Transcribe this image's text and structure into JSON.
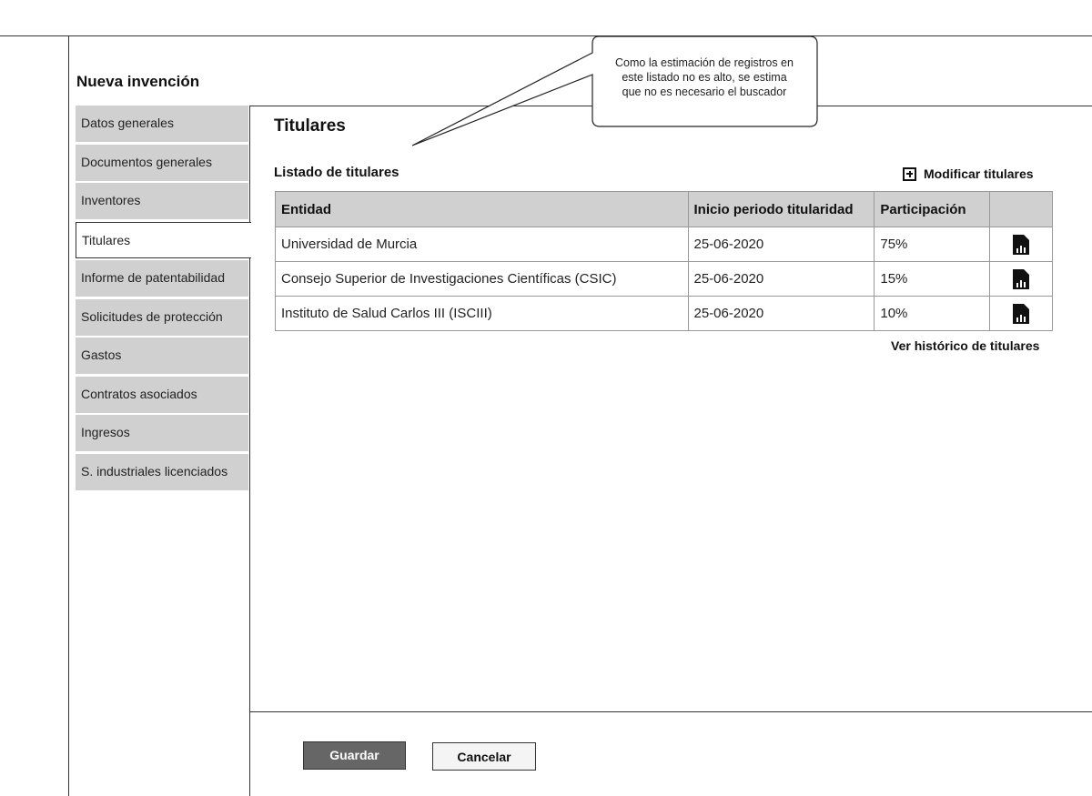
{
  "page": {
    "title": "Nueva invención"
  },
  "nav": {
    "items": [
      {
        "label": "Datos generales",
        "active": false
      },
      {
        "label": "Documentos generales",
        "active": false
      },
      {
        "label": "Inventores",
        "active": false
      },
      {
        "label": "Titulares",
        "active": true
      },
      {
        "label": "Informe de patentabilidad",
        "active": false
      },
      {
        "label": "Solicitudes de protección",
        "active": false
      },
      {
        "label": "Gastos",
        "active": false
      },
      {
        "label": "Contratos asociados",
        "active": false
      },
      {
        "label": "Ingresos",
        "active": false
      },
      {
        "label": "S. industriales licenciados",
        "active": false
      }
    ]
  },
  "section": {
    "title": "Titulares",
    "list_title": "Listado de titulares",
    "modify_label": "Modificar titulares",
    "history_label": "Ver histórico de titulares"
  },
  "table": {
    "headers": [
      "Entidad",
      "Inicio periodo titularidad",
      "Participación",
      ""
    ],
    "rows": [
      {
        "entidad": "Universidad de Murcia",
        "inicio": "25-06-2020",
        "participacion": "75%",
        "icon": "report-document-icon"
      },
      {
        "entidad": "Consejo Superior de Investigaciones Científicas (CSIC)",
        "inicio": "25-06-2020",
        "participacion": "15%",
        "icon": "report-document-icon"
      },
      {
        "entidad": "Instituto de Salud Carlos III (ISCIII)",
        "inicio": "25-06-2020",
        "participacion": "10%",
        "icon": "report-document-icon"
      }
    ]
  },
  "callout": {
    "lines": [
      "Como la estimación de registros en",
      "este listado no es alto, se estima",
      "que no es necesario el buscador"
    ]
  },
  "footer": {
    "save_label": "Guardar",
    "cancel_label": "Cancelar"
  },
  "colors": {
    "nav_bg": "#d0d0d0",
    "save_bg": "#666666",
    "cancel_bg": "#f4f4f4",
    "border": "#333333"
  }
}
